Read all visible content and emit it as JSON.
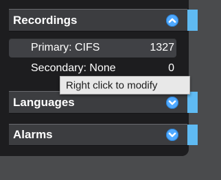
{
  "sections": [
    {
      "id": "recordings",
      "label": "Recordings",
      "icon": "chevron-up-icon",
      "expanded": true
    },
    {
      "id": "languages",
      "label": "Languages",
      "icon": "chevron-down-icon",
      "expanded": false
    },
    {
      "id": "alarms",
      "label": "Alarms",
      "icon": "chevron-down-icon",
      "expanded": false
    }
  ],
  "recordings_rows": [
    {
      "label": "Primary: CIFS",
      "value": "1327",
      "selected": true
    },
    {
      "label": "Secondary: None",
      "value": "0",
      "selected": false
    }
  ],
  "tooltip": {
    "text": "Right click to modify"
  },
  "colors": {
    "accent": "#5fbaf2",
    "chevron": "#4fa9ff",
    "panel": "#1d1d1f"
  }
}
